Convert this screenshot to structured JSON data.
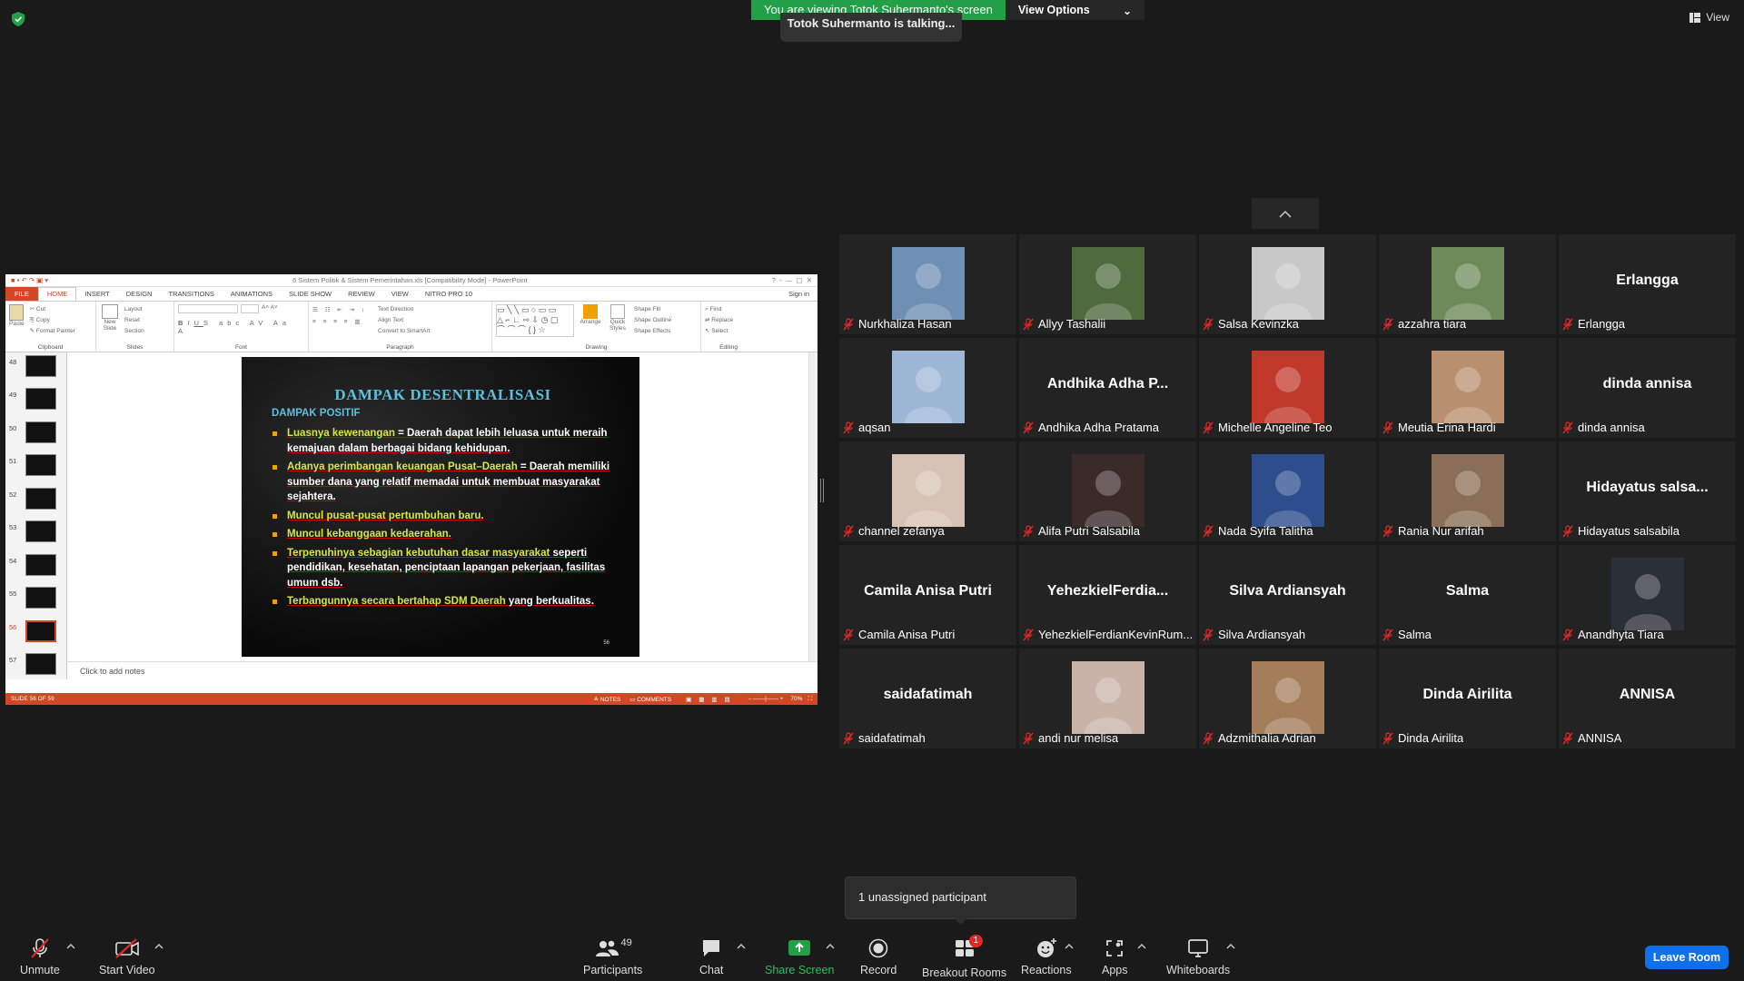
{
  "banner": {
    "viewing_text": "You are viewing Totok Suhermanto's screen",
    "view_options": "View Options",
    "talking": "Totok Suhermanto is talking...",
    "view_label": "View"
  },
  "powerpoint": {
    "window_title": "6 Sistem Politik & Sistem Pemerintahan.xls [Compatibility Mode] - PowerPoint",
    "sign_in": "Sign in",
    "tabs": [
      "FILE",
      "HOME",
      "INSERT",
      "DESIGN",
      "TRANSITIONS",
      "ANIMATIONS",
      "SLIDE SHOW",
      "REVIEW",
      "VIEW",
      "NITRO PRO 10"
    ],
    "groups": {
      "clipboard": "Clipboard",
      "slides": "Slides",
      "font": "Font",
      "paragraph": "Paragraph",
      "drawing": "Drawing",
      "editing": "Editing"
    },
    "ribbon": {
      "paste": "Paste",
      "cut": "Cut",
      "copy": "Copy",
      "format_painter": "Format Painter",
      "new_slide": "New Slide",
      "layout": "Layout",
      "reset": "Reset",
      "section": "Section",
      "text_direction": "Text Direction",
      "align_text": "Align Text",
      "convert_smartart": "Convert to SmartArt",
      "arrange": "Arrange",
      "quick_styles": "Quick Styles",
      "shape_fill": "Shape Fill",
      "shape_outline": "Shape Outline",
      "shape_effects": "Shape Effects",
      "find": "Find",
      "replace": "Replace",
      "select": "Select"
    },
    "thumbnails": [
      "48",
      "49",
      "50",
      "51",
      "52",
      "53",
      "54",
      "55",
      "56",
      "57"
    ],
    "selected_thumb": "56",
    "slide": {
      "title": "DAMPAK DESENTRALISASI",
      "subtitle": "DAMPAK POSITIF",
      "bullets": [
        {
          "g": "Luasnya kewenangan",
          "w": " = Daerah dapat lebih leluasa untuk meraih kemajuan dalam berbagai bidang kehidupan."
        },
        {
          "g": "Adanya perimbangan keuangan Pusat–Daerah",
          "w": " = Daerah memiliki sumber dana yang relatif memadai untuk membuat masyarakat sejahtera."
        },
        {
          "g": "Muncul pusat-pusat pertumbuhan baru.",
          "w": ""
        },
        {
          "g": "Muncul kebanggaan kedaerahan.",
          "w": ""
        },
        {
          "g": "Terpenuhinya sebagian kebutuhan dasar masyarakat",
          "w": " seperti pendidikan, kesehatan, penciptaan lapangan pekerjaan, fasilitas umum dsb."
        },
        {
          "g": "Terbangunnya secara bertahap SDM Daerah",
          "w": " yang berkualitas."
        }
      ],
      "page_number": "56"
    },
    "notes_placeholder": "Click to add notes",
    "status": {
      "slide_of": "SLIDE 56 OF 59",
      "notes": "NOTES",
      "comments": "COMMENTS",
      "zoom": "70%"
    }
  },
  "participants": [
    {
      "name": "Nurkhaliza Hasan",
      "video": true,
      "bg": "#6f8fb5"
    },
    {
      "name": "Allyy Tashalii",
      "video": true,
      "bg": "#4f6b3e"
    },
    {
      "name": "Salsa Kevinzka",
      "video": true,
      "bg": "#c8c8c8"
    },
    {
      "name": "azzahra tiara",
      "video": true,
      "bg": "#6f8a5a"
    },
    {
      "name": "Erlangga",
      "video": false,
      "display": "Erlangga"
    },
    {
      "name": "aqsan",
      "video": true,
      "bg": "#9fb7d6"
    },
    {
      "name": "Andhika Adha Pratama",
      "video": false,
      "display": "Andhika Adha P..."
    },
    {
      "name": "Michelle Angeline Teo",
      "video": true,
      "bg": "#c0392b"
    },
    {
      "name": "Meutia Erina Hardi",
      "video": true,
      "bg": "#b89070"
    },
    {
      "name": "dinda annisa",
      "video": false,
      "display": "dinda annisa"
    },
    {
      "name": "channel zefanya",
      "video": true,
      "bg": "#d7c3b5"
    },
    {
      "name": "Alifa Putri Salsabila",
      "video": true,
      "bg": "#3a2a2a"
    },
    {
      "name": "Nada Syifa Talitha",
      "video": true,
      "bg": "#2d4d8c"
    },
    {
      "name": "Rania Nur arifah",
      "video": true,
      "bg": "#8a6e58"
    },
    {
      "name": "Hidayatus salsabila",
      "video": false,
      "display": "Hidayatus  salsa..."
    },
    {
      "name": "Camila Anisa Putri",
      "video": false,
      "display": "Camila Anisa Putri"
    },
    {
      "name": "YehezkielFerdianKevinRum...",
      "video": false,
      "display": "YehezkielFerdia..."
    },
    {
      "name": "Silva Ardiansyah",
      "video": false,
      "display": "Silva Ardiansyah"
    },
    {
      "name": "Salma",
      "video": false,
      "display": "Salma"
    },
    {
      "name": "Anandhyta Tiara",
      "video": true,
      "bg": "#2b2f38"
    },
    {
      "name": "saidafatimah",
      "video": false,
      "display": "saidafatimah"
    },
    {
      "name": "andi nur melisa",
      "video": true,
      "bg": "#c9b3a8"
    },
    {
      "name": "Adzmithalia Adrian",
      "video": true,
      "bg": "#a47d5a"
    },
    {
      "name": "Dinda Airilita",
      "video": false,
      "display": "Dinda Airilita"
    },
    {
      "name": "ANNISA",
      "video": false,
      "display": "ANNISA"
    }
  ],
  "popup": {
    "text": "1 unassigned participant"
  },
  "toolbar": {
    "unmute": "Unmute",
    "start_video": "Start Video",
    "participants": "Participants",
    "participants_count": "49",
    "chat": "Chat",
    "share_screen": "Share Screen",
    "record": "Record",
    "breakout_rooms": "Breakout Rooms",
    "breakout_badge": "1",
    "reactions": "Reactions",
    "apps": "Apps",
    "whiteboards": "Whiteboards",
    "leave": "Leave Room"
  },
  "colors": {
    "share_green": "#23a047",
    "leave_blue": "#0e71eb",
    "ppt_orange": "#d24726",
    "muted_red": "#e02828"
  }
}
